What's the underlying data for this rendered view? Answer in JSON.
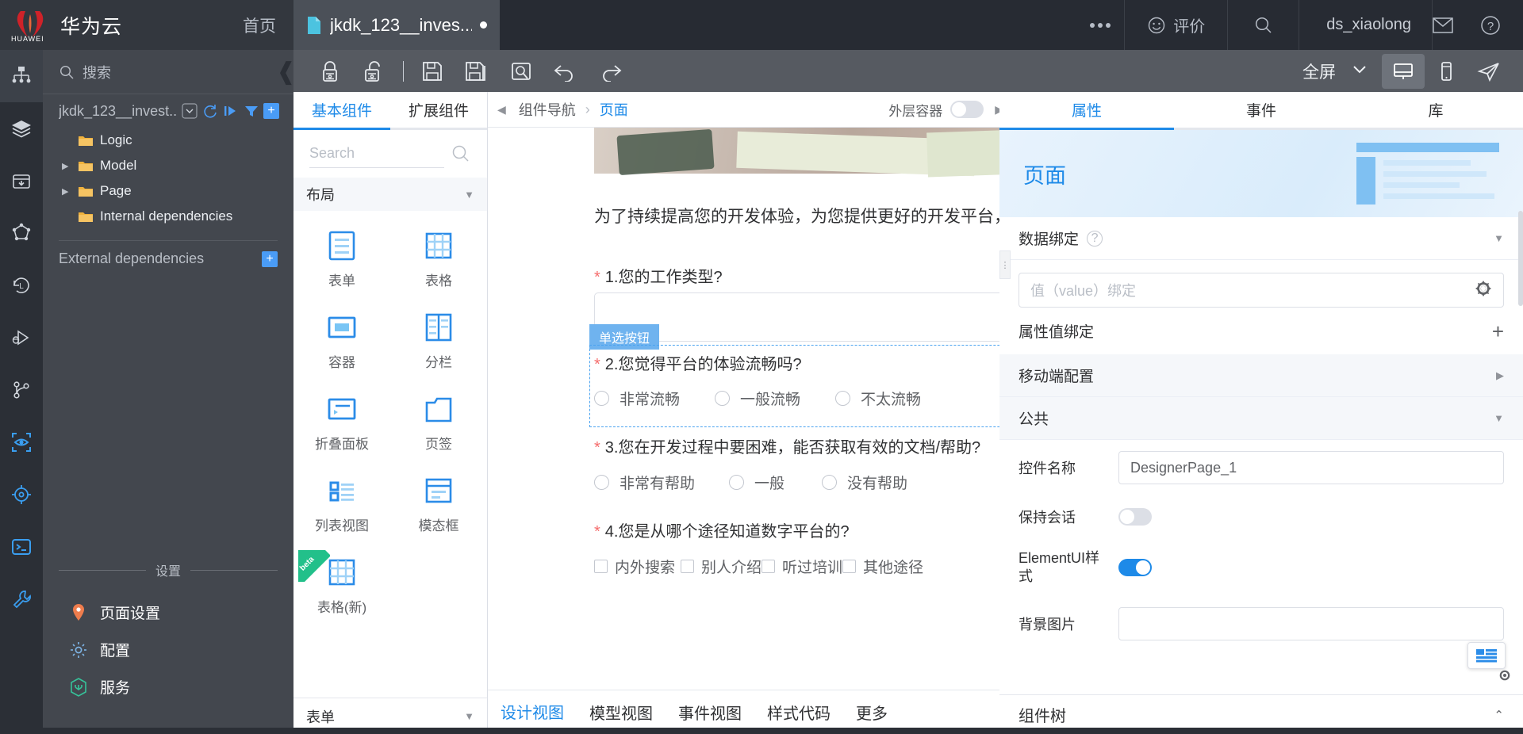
{
  "topbar": {
    "brand": "华为云",
    "brand_logo_icon": "huawei-flower-logo",
    "brand_sub": "HUAWEI",
    "home_label": "首页",
    "tab": {
      "title": "jkdk_123__inves...",
      "icon": "file-icon",
      "modified_dot": "●"
    },
    "more_icon": "more-dots-icon",
    "evaluate_label": "评价",
    "evaluate_icon": "smiley-icon",
    "search_icon": "search-icon",
    "user_name": "ds_xiaolong",
    "mail_icon": "envelope-icon",
    "help_icon": "question-circle-icon"
  },
  "rail": {
    "items": [
      {
        "name": "sitemap-icon",
        "label": "结构"
      },
      {
        "name": "layers-icon",
        "label": "图层"
      },
      {
        "name": "package-download-icon",
        "label": "依赖"
      },
      {
        "name": "graph-nodes-icon",
        "label": "关系图"
      },
      {
        "name": "history-clock-icon",
        "label": "历史"
      },
      {
        "name": "debug-run-icon",
        "label": "调试"
      },
      {
        "name": "git-branch-icon",
        "label": "分支"
      },
      {
        "name": "preview-eye-icon",
        "label": "预览"
      },
      {
        "name": "target-icon",
        "label": "定位"
      },
      {
        "name": "terminal-icon",
        "label": "终端"
      },
      {
        "name": "wrench-icon",
        "label": "工具"
      }
    ]
  },
  "explorer": {
    "search_placeholder": "搜索",
    "search_icon": "search-icon",
    "project_name": "jkdk_123__invest...",
    "project_actions": [
      "chevron-down-box-icon",
      "refresh-icon",
      "run-icon",
      "filter-icon",
      "add-icon"
    ],
    "tree": [
      {
        "label": "Logic",
        "expandable": false
      },
      {
        "label": "Model",
        "expandable": true
      },
      {
        "label": "Page",
        "expandable": true
      },
      {
        "label": "Internal dependencies",
        "expandable": false
      }
    ],
    "external_dependencies_label": "External dependencies",
    "external_add_icon": "plus-icon",
    "settings_divider_label": "设置",
    "settings_items": [
      {
        "label": "页面设置",
        "icon": "map-pin-icon",
        "color": "#ef7d4d"
      },
      {
        "label": "配置",
        "icon": "gear-icon",
        "color": "#7fb6e8"
      },
      {
        "label": "服务",
        "icon": "hexagon-service-icon",
        "color": "#36c39a"
      }
    ]
  },
  "toolbar": {
    "collapse_icon": "collapse-left-icon",
    "icons": [
      "lock-closed-icon",
      "lock-open-icon",
      "divider",
      "save-icon",
      "save-as-icon",
      "preview-search-icon",
      "undo-icon",
      "redo-icon"
    ],
    "fullscreen_label": "全屏",
    "fullscreen_chevron": "chevron-down-icon",
    "device_desktop_icon": "desktop-icon",
    "device_mobile_icon": "mobile-icon",
    "send_icon": "send-paper-plane-icon"
  },
  "components": {
    "tabs": [
      {
        "label": "基本组件",
        "active": true
      },
      {
        "label": "扩展组件",
        "active": false
      }
    ],
    "search_placeholder": "Search",
    "search_icon": "search-icon",
    "group_title": "布局",
    "group_chevron": "chevron-down-icon",
    "items": [
      {
        "label": "表单",
        "icon": "form-icon"
      },
      {
        "label": "表格",
        "icon": "table-icon"
      },
      {
        "label": "容器",
        "icon": "container-icon"
      },
      {
        "label": "分栏",
        "icon": "columns-icon"
      },
      {
        "label": "折叠面板",
        "icon": "collapse-panel-icon"
      },
      {
        "label": "页签",
        "icon": "tab-page-icon"
      },
      {
        "label": "列表视图",
        "icon": "list-view-icon"
      },
      {
        "label": "模态框",
        "icon": "modal-icon"
      },
      {
        "label": "表格(新)",
        "icon": "table-new-icon",
        "badge": "beta"
      }
    ],
    "footer_title": "表单",
    "footer_chevron": "chevron-down-icon"
  },
  "canvas": {
    "breadcrumb_collapse_icon": "chevron-left-icon",
    "breadcrumb": [
      {
        "label": "组件导航",
        "active": false
      },
      {
        "label": "页面",
        "active": true
      }
    ],
    "breadcrumb_separator": "›",
    "outer_container_label": "外层容器",
    "outer_container_on": false,
    "breadcrumb_expand_icon": "chevron-right-icon",
    "intro_text": "为了持续提高您的开发体验，为您提供更好的开发平台，",
    "selection_badge": "单选按钮",
    "questions": [
      {
        "required": true,
        "number": "1.",
        "text": "您的工作类型?",
        "control": "textarea",
        "options": []
      },
      {
        "required": true,
        "number": "2.",
        "text": "您觉得平台的体验流畅吗?",
        "control": "radio",
        "options": [
          "非常流畅",
          "一般流畅",
          "不太流畅"
        ],
        "selected": true
      },
      {
        "required": true,
        "number": "3.",
        "text": "您在开发过程中要困难，能否获取有效的文档/帮助?",
        "control": "radio",
        "options": [
          "非常有帮助",
          "一般",
          "没有帮助"
        ]
      },
      {
        "required": true,
        "number": "4.",
        "text": "您是从哪个途径知道数字平台的?",
        "control": "checkbox",
        "options": [
          "内外搜索",
          "别人介绍",
          "听过培训",
          "其他途径"
        ]
      }
    ],
    "footer_tabs": [
      {
        "label": "设计视图",
        "active": true
      },
      {
        "label": "模型视图",
        "active": false
      },
      {
        "label": "事件视图",
        "active": false
      },
      {
        "label": "样式代码",
        "active": false
      },
      {
        "label": "更多",
        "active": false
      }
    ]
  },
  "properties": {
    "tabs": [
      {
        "label": "属性",
        "active": true
      },
      {
        "label": "事件",
        "active": false
      },
      {
        "label": "库",
        "active": false
      }
    ],
    "hero_title": "页面",
    "hero_icon": "page-wireframe-icon",
    "data_binding": {
      "title": "数据绑定",
      "help_icon": "question-circle-icon",
      "collapse_icon": "chevron-down-icon",
      "value_placeholder": "值（value）绑定",
      "value_gear_icon": "gear-icon",
      "attr_binding_label": "属性值绑定",
      "attr_add_icon": "plus-icon"
    },
    "mobile_config": {
      "title": "移动端配置",
      "expand_icon": "chevron-right-icon"
    },
    "public": {
      "title": "公共",
      "collapse_icon": "chevron-down-icon",
      "rows": [
        {
          "key": "控件名称",
          "type": "text",
          "value": "DesignerPage_1"
        },
        {
          "key": "保持会话",
          "type": "toggle",
          "value": false
        },
        {
          "key": "ElementUI样式",
          "type": "toggle",
          "value": true
        },
        {
          "key": "背景图片",
          "type": "text",
          "value": ""
        }
      ]
    },
    "bottom_bar_label": "组件树",
    "bottom_bar_chevron": "chevron-up-icon",
    "float_widget_icon": "layout-card-icon",
    "float_gear_icon": "gear-icon"
  },
  "colors": {
    "accent_blue": "#1e8ae8",
    "dark_bg": "#2b2f36",
    "panel_dark": "#43474e",
    "toolbar_grey": "#565a61",
    "folder_yellow": "#f0b23c",
    "required_red": "#f56c6c",
    "huawei_red": "#cf2229"
  }
}
